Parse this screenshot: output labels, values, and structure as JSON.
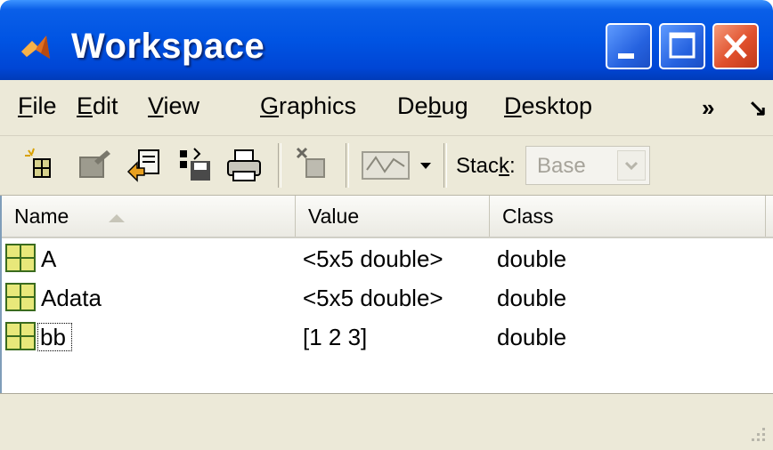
{
  "window": {
    "title": "Workspace"
  },
  "menu": {
    "items": [
      {
        "label_pre": "",
        "label_ul": "F",
        "label_post": "ile"
      },
      {
        "label_pre": "",
        "label_ul": "E",
        "label_post": "dit"
      },
      {
        "label_pre": "",
        "label_ul": "V",
        "label_post": "iew"
      },
      {
        "label_pre": "",
        "label_ul": "G",
        "label_post": "raphics"
      },
      {
        "label_pre": "De",
        "label_ul": "b",
        "label_post": "ug"
      },
      {
        "label_pre": "",
        "label_ul": "D",
        "label_post": "esktop"
      }
    ],
    "overflow": "»",
    "corner": "↘"
  },
  "toolbar": {
    "stack_label_pre": "Stac",
    "stack_label_ul": "k",
    "stack_label_post": ":",
    "stack_value": "Base"
  },
  "table": {
    "columns": [
      "Name",
      "Value",
      "Class"
    ],
    "rows": [
      {
        "name": "A",
        "value": "<5x5 double>",
        "class": "double"
      },
      {
        "name": "Adata",
        "value": "<5x5 double>",
        "class": "double"
      },
      {
        "name": "bb",
        "value": "[1 2 3]",
        "class": "double"
      }
    ]
  },
  "colors": {
    "title_bar": "#0054e3",
    "close_button": "#e0502c",
    "variable_icon": "#e8e87a"
  }
}
